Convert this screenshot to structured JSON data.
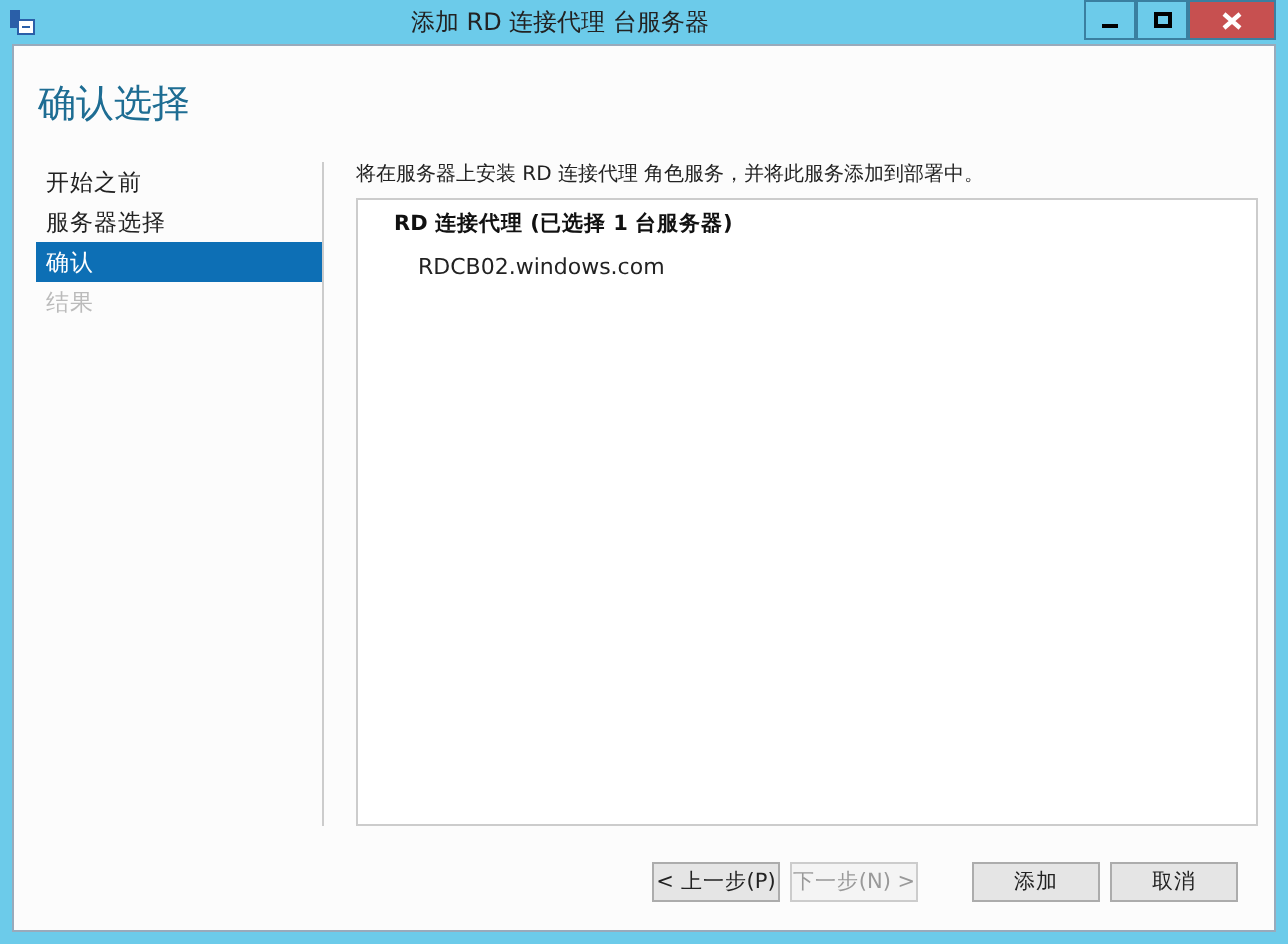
{
  "window": {
    "title": "添加 RD 连接代理 台服务器"
  },
  "page_title": "确认选择",
  "nav": [
    {
      "label": "开始之前",
      "selected": false,
      "disabled": false
    },
    {
      "label": "服务器选择",
      "selected": false,
      "disabled": false
    },
    {
      "label": "确认",
      "selected": true,
      "disabled": false
    },
    {
      "label": "结果",
      "selected": false,
      "disabled": true
    }
  ],
  "description": "将在服务器上安装 RD 连接代理 角色服务，并将此服务添加到部署中。",
  "summary": {
    "heading": "RD 连接代理 (已选择 1 台服务器)",
    "servers": [
      "RDCB02.windows.com"
    ]
  },
  "buttons": [
    {
      "label": "< 上一步(P)",
      "disabled": false
    },
    {
      "label": "下一步(N) >",
      "disabled": true
    },
    {
      "label": "添加",
      "disabled": false
    },
    {
      "label": "取消",
      "disabled": false
    }
  ]
}
